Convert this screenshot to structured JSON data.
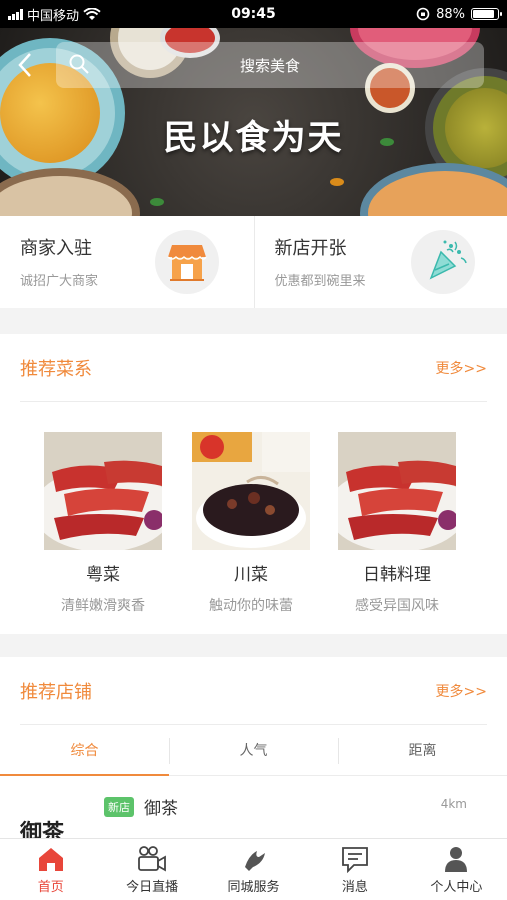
{
  "status_bar": {
    "carrier": "中国移动",
    "time": "09:45",
    "battery_percent": "88%",
    "battery_level": 0.88
  },
  "header": {
    "search_placeholder": "搜索美食",
    "slogan": "民以食为天"
  },
  "promo": [
    {
      "title": "商家入驻",
      "subtitle": "诚招广大商家",
      "icon": "storefront-icon"
    },
    {
      "title": "新店开张",
      "subtitle": "优惠都到碗里来",
      "icon": "party-popper-icon"
    }
  ],
  "recommended_cuisine": {
    "title": "推荐菜系",
    "more": "更多>>",
    "items": [
      {
        "name": "粤菜",
        "desc": "清鲜嫩滑爽香"
      },
      {
        "name": "川菜",
        "desc": "触动你的味蕾"
      },
      {
        "name": "日韩料理",
        "desc": "感受异国风味"
      }
    ]
  },
  "recommended_shops": {
    "title": "推荐店铺",
    "more": "更多>>",
    "tabs": [
      "综合",
      "人气",
      "距离"
    ],
    "active_tab": "综合",
    "shop": {
      "badge": "新店",
      "name": "御茶",
      "distance": "4km",
      "logo_text": "御茶"
    }
  },
  "tabbar": [
    {
      "label": "首页",
      "icon": "home-icon",
      "active": true
    },
    {
      "label": "今日直播",
      "icon": "video-camera-icon",
      "active": false
    },
    {
      "label": "同城服务",
      "icon": "bird-icon",
      "active": false
    },
    {
      "label": "消息",
      "icon": "message-icon",
      "active": false
    },
    {
      "label": "个人中心",
      "icon": "user-icon",
      "active": false
    }
  ],
  "colors": {
    "accent": "#f08a3c",
    "active_tab": "#e8463a",
    "badge_green": "#5cc36a"
  }
}
